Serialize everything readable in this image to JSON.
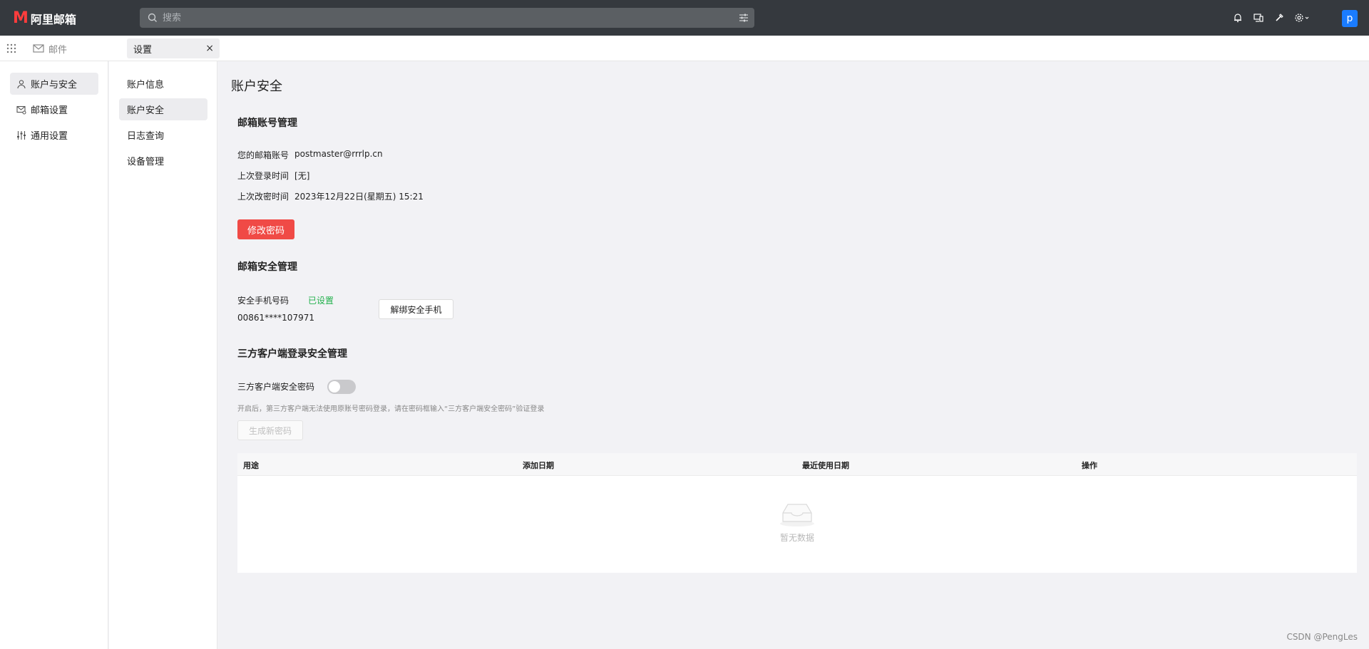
{
  "app": {
    "logo_mark": "M",
    "logo_text": "阿里邮箱"
  },
  "search": {
    "placeholder": "搜索"
  },
  "topbar": {
    "icons": [
      "bell-icon",
      "devices-icon",
      "brush-icon",
      "gear-icon"
    ],
    "avatar_letter": "p"
  },
  "tabs": {
    "mail": "邮件",
    "settings": "设置",
    "close": "×"
  },
  "leftnav": {
    "items": [
      {
        "label": "账户与安全",
        "icon": "user-icon"
      },
      {
        "label": "邮箱设置",
        "icon": "mailbox-settings-icon"
      },
      {
        "label": "通用设置",
        "icon": "sliders-icon"
      }
    ]
  },
  "subnav": {
    "items": [
      {
        "label": "账户信息"
      },
      {
        "label": "账户安全"
      },
      {
        "label": "日志查询"
      },
      {
        "label": "设备管理"
      }
    ]
  },
  "main": {
    "title": "账户安全",
    "account_section": {
      "title": "邮箱账号管理",
      "rows": [
        {
          "label": "您的邮箱账号",
          "value": "postmaster@rrrlp.cn"
        },
        {
          "label": "上次登录时间",
          "value": "[无]"
        },
        {
          "label": "上次改密时间",
          "value": "2023年12月22日(星期五) 15:21"
        }
      ],
      "change_password": "修改密码"
    },
    "security_section": {
      "title": "邮箱安全管理",
      "phone_label": "安全手机号码",
      "phone_status": "已设置",
      "phone_number": "00861****107971",
      "unbind_button": "解绑安全手机"
    },
    "client_section": {
      "title": "三方客户端登录安全管理",
      "toggle_label": "三方客户端安全密码",
      "toggle_on": false,
      "hint": "开启后，第三方客户端无法使用原账号密码登录，请在密码框输入“三方客户端安全密码”验证登录",
      "generate_button": "生成新密码"
    },
    "table": {
      "columns": [
        "用途",
        "添加日期",
        "最近使用日期",
        "操作"
      ],
      "empty_text": "暂无数据"
    }
  },
  "watermark": "CSDN @PengLes",
  "colors": {
    "topbar": "#35393e",
    "accent_red": "#f04a46",
    "status_green": "#22b14c",
    "avatar_blue": "#1a7cff"
  }
}
